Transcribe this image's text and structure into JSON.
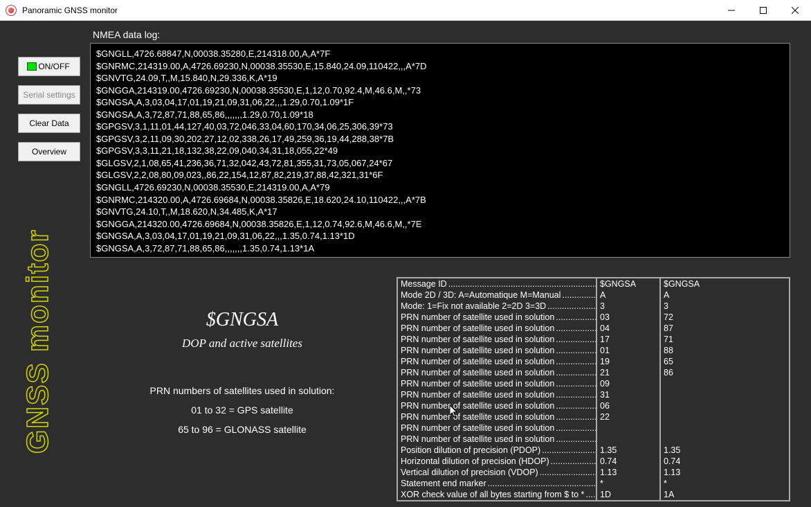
{
  "window": {
    "title": "Panoramic GNSS monitor"
  },
  "buttons": {
    "onoff": "ON/OFF",
    "serial": "Serial settings",
    "clear": "Clear Data",
    "overview": "Overview"
  },
  "vertical_label": "GNSS monitor",
  "log": {
    "label": "NMEA data log:",
    "lines": [
      "$GNGLL,4726.68847,N,00038.35280,E,214318.00,A,A*7F",
      "$GNRMC,214319.00,A,4726.69230,N,00038.35530,E,15.840,24.09,110422,,,A*7D",
      "$GNVTG,24.09,T,,M,15.840,N,29.336,K,A*19",
      "$GNGGA,214319.00,4726.69230,N,00038.35530,E,1,12,0.70,92.4,M,46.6,M,,*73",
      "$GNGSA,A,3,03,04,17,01,19,21,09,31,06,22,,,1.29,0.70,1.09*1F",
      "$GNGSA,A,3,72,87,71,88,65,86,,,,,,,1.29,0.70,1.09*18",
      "$GPGSV,3,1,11,01,44,127,40,03,72,046,33,04,60,170,34,06,25,306,39*73",
      "$GPGSV,3,2,11,09,30,202,27,12,02,338,26,17,49,259,36,19,44,288,38*7B",
      "$GPGSV,3,3,11,21,18,132,38,22,09,040,34,31,18,055,22*49",
      "$GLGSV,2,1,08,65,41,236,36,71,32,042,43,72,81,355,31,73,05,067,24*67",
      "$GLGSV,2,2,08,80,09,023,,86,22,154,12,87,82,219,37,88,42,321,31*6F",
      "$GNGLL,4726.69230,N,00038.35530,E,214319.00,A,A*79",
      "$GNRMC,214320.00,A,4726.69684,N,00038.35826,E,18.620,24.10,110422,,,A*7B",
      "$GNVTG,24.10,T,,M,18.620,N,34.485,K,A*17",
      "$GNGGA,214320.00,4726.69684,N,00038.35826,E,1,12,0.74,92.6,M,46.6,M,,*7E",
      "$GNGSA,A,3,03,04,17,01,19,21,09,31,06,22,,,1.35,0.74,1.13*1D",
      "$GNGSA,A,3,72,87,71,88,65,86,,,,,,,1.35,0.74,1.13*1A"
    ]
  },
  "detail": {
    "msg_id": "$GNGSA",
    "msg_desc": "DOP and active satellites",
    "prn_title": "PRN numbers of satellites used in solution:",
    "prn_gps": "01 to 32 = GPS satellite",
    "prn_glonass": "65 to 96 =  GLONASS satellite"
  },
  "grid": {
    "headers": [
      "$GNGSA",
      "$GNGSA"
    ],
    "rows": [
      {
        "label": "Message ID",
        "v1": "$GNGSA",
        "v2": "$GNGSA"
      },
      {
        "label": "Mode 2D / 3D: A=Automatique M=Manual",
        "v1": "A",
        "v2": "A"
      },
      {
        "label": "Mode: 1=Fix not available 2=2D 3=3D",
        "v1": "3",
        "v2": "3"
      },
      {
        "label": "PRN number of satellite used in solution",
        "v1": "03",
        "v2": "72"
      },
      {
        "label": "PRN number of satellite used in solution",
        "v1": "04",
        "v2": "87"
      },
      {
        "label": "PRN number of satellite used in solution",
        "v1": "17",
        "v2": "71"
      },
      {
        "label": "PRN number of satellite used in solution",
        "v1": "01",
        "v2": "88"
      },
      {
        "label": "PRN number of satellite used in solution",
        "v1": "19",
        "v2": "65"
      },
      {
        "label": "PRN number of satellite used in solution",
        "v1": "21",
        "v2": "86"
      },
      {
        "label": "PRN number of satellite used in solution",
        "v1": "09",
        "v2": ""
      },
      {
        "label": "PRN number of satellite used in solution",
        "v1": "31",
        "v2": ""
      },
      {
        "label": "PRN number of satellite used in solution",
        "v1": "06",
        "v2": ""
      },
      {
        "label": "PRN number of satellite used in solution",
        "v1": "22",
        "v2": ""
      },
      {
        "label": "PRN number of satellite used in solution",
        "v1": "",
        "v2": ""
      },
      {
        "label": "PRN number of satellite used in solution",
        "v1": "",
        "v2": ""
      },
      {
        "label": "Position dilution of precision (PDOP)",
        "v1": "1.35",
        "v2": "1.35"
      },
      {
        "label": "Horizontal dilution of precision (HDOP)",
        "v1": "0.74",
        "v2": "0.74"
      },
      {
        "label": "Vertical dilution of precision (VDOP)",
        "v1": "1.13",
        "v2": "1.13"
      },
      {
        "label": "Statement end marker",
        "v1": "*",
        "v2": "*"
      },
      {
        "label": "XOR check value of all bytes starting from $ to *",
        "v1": "1D",
        "v2": "1A"
      }
    ]
  }
}
